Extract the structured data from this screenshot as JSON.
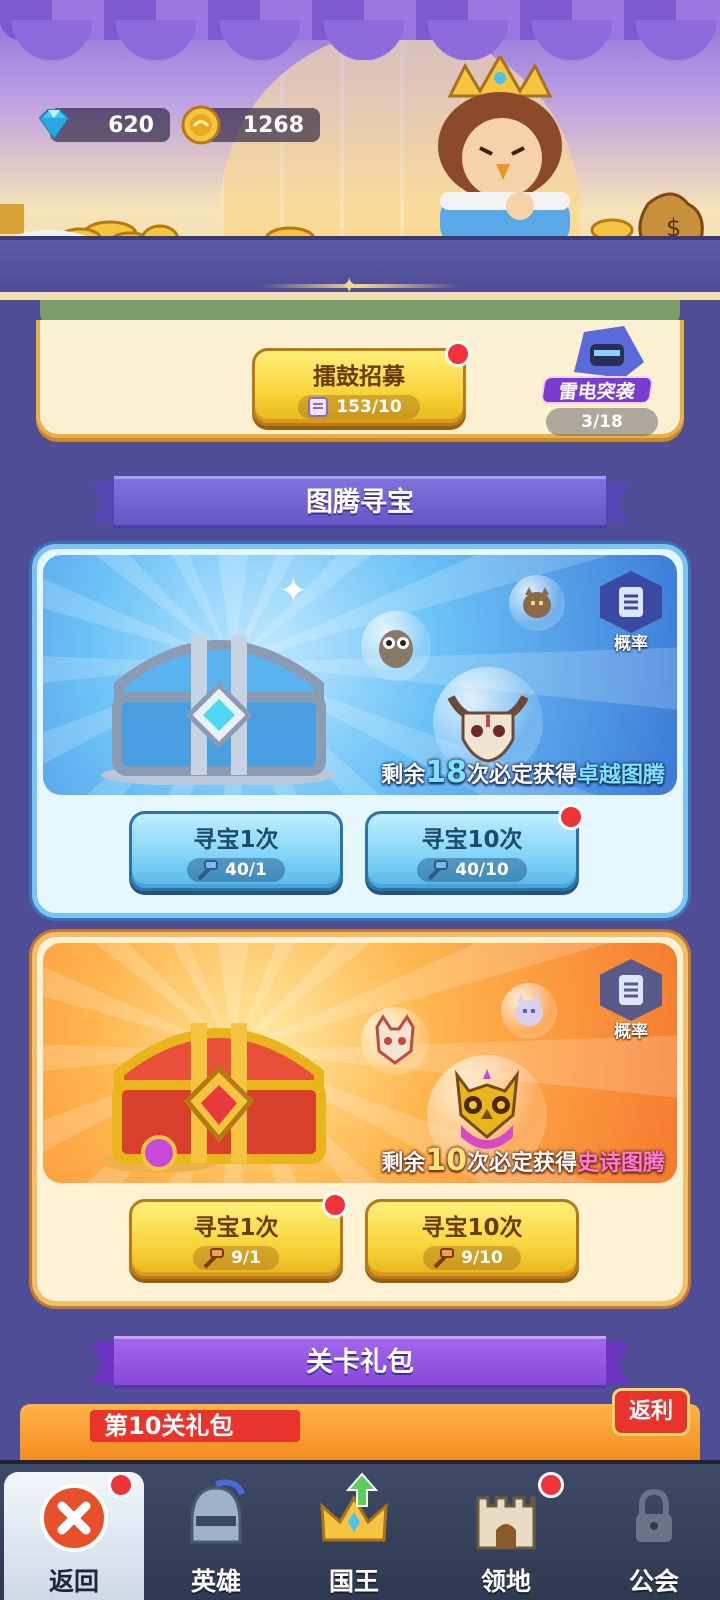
{
  "currency": {
    "gems": "620",
    "gold": "1268"
  },
  "recruit": {
    "button_label": "擂鼓招募",
    "button_cost": "153/10",
    "event_name": "雷电突袭",
    "event_progress": "3/18"
  },
  "sections": {
    "totem_hunt_title": "图腾寻宝",
    "stage_gift_title": "关卡礼包"
  },
  "blue_chest": {
    "probability_label": "概率",
    "guarantee_prefix": "剩余",
    "guarantee_count": "18",
    "guarantee_mid": "次必定获得",
    "guarantee_reward": "卓越图腾",
    "draw_one_label": "寻宝1次",
    "draw_one_cost": "40/1",
    "draw_ten_label": "寻宝10次",
    "draw_ten_cost": "40/10"
  },
  "orange_chest": {
    "probability_label": "概率",
    "guarantee_prefix": "剩余",
    "guarantee_count": "10",
    "guarantee_mid": "次必定获得",
    "guarantee_reward": "史诗图腾",
    "draw_one_label": "寻宝1次",
    "draw_one_cost": "9/1",
    "draw_ten_label": "寻宝10次",
    "draw_ten_cost": "9/10"
  },
  "gift_strip": {
    "label": "第10关礼包",
    "rebate": "返利"
  },
  "nav": {
    "back": "返回",
    "heroes": "英雄",
    "king": "国王",
    "territory": "领地",
    "guild": "公会"
  },
  "colors": {
    "background": "#4f4d96",
    "red_dot": "#f0323a",
    "gold_button": "#f7d33a",
    "blue_button": "#7fd3f5"
  },
  "icons": [
    "diamond-icon",
    "gold-coin-icon",
    "scroll-icon",
    "hammer-icon",
    "document-icon",
    "close-icon",
    "helmet-icon",
    "crown-icon",
    "castle-icon",
    "lock-icon",
    "up-arrow-icon"
  ]
}
